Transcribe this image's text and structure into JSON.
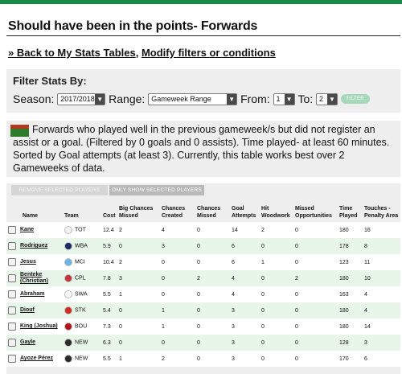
{
  "page": {
    "title": "Should have been in the points- Forwards",
    "back_link": "» Back to My Stats Tables",
    "separator": ",",
    "modify_link": "Modify filters or conditions",
    "accent_color": "#1a8a4a"
  },
  "filter": {
    "heading": "Filter Stats By:",
    "season_label": "Season:",
    "season_value": "2017/2018",
    "range_label": "Range:",
    "range_value": "Gameweek Range",
    "from_label": "From:",
    "from_value": "1",
    "to_label": "To:",
    "to_value": "2",
    "filter_button": "FILTER"
  },
  "description": {
    "icon": "pitch-icon",
    "text": "Forwards who played well in the previous gameweek/s but did not register an assist or a goal. (Filtered by 0 goals and 0 assists). Time played- at least 60 minutes. Sorted by Goal attempts (at least 3). Currently, this table works best over 2 Gameweeks of data."
  },
  "table": {
    "remove_selected_label": "REMOVE SELECTED PLAYERS",
    "only_show_selected_label": "ONLY SHOW SELECTED PLAYERS",
    "columns": [
      "Name",
      "Team",
      "Cost",
      "Big Chances Missed",
      "Chances Created",
      "Chances Missed",
      "Goal Attempts",
      "Hit Woodwork",
      "Missed Opportunities",
      "Time Played",
      "Touches - Penalty Area"
    ],
    "rows": [
      {
        "name": "Kane",
        "team": "TOT",
        "kit_color": "#f2f2f2",
        "cost": "12.4",
        "big_chances_missed": "2",
        "chances_created": "4",
        "chances_missed": "0",
        "goal_attempts": "14",
        "hit_woodwork": "2",
        "missed_opportunities": "0",
        "time_played": "180",
        "touches_penalty_area": "16"
      },
      {
        "name": "Rodriguez",
        "team": "WBA",
        "kit_color": "#1b2a63",
        "cost": "5.9",
        "big_chances_missed": "0",
        "chances_created": "3",
        "chances_missed": "0",
        "goal_attempts": "6",
        "hit_woodwork": "0",
        "missed_opportunities": "0",
        "time_played": "178",
        "touches_penalty_area": "8"
      },
      {
        "name": "Jesus",
        "team": "MCI",
        "kit_color": "#6cb4e4",
        "cost": "10.4",
        "big_chances_missed": "2",
        "chances_created": "0",
        "chances_missed": "0",
        "goal_attempts": "6",
        "hit_woodwork": "1",
        "missed_opportunities": "0",
        "time_played": "123",
        "touches_penalty_area": "11"
      },
      {
        "name": "Benteke (Christian)",
        "team": "CPL",
        "kit_color": "#c4343a",
        "cost": "7.8",
        "big_chances_missed": "3",
        "chances_created": "0",
        "chances_missed": "2",
        "goal_attempts": "4",
        "hit_woodwork": "0",
        "missed_opportunities": "2",
        "time_played": "180",
        "touches_penalty_area": "10"
      },
      {
        "name": "Abraham",
        "team": "SWA",
        "kit_color": "#f7f7f7",
        "cost": "5.5",
        "big_chances_missed": "1",
        "chances_created": "0",
        "chances_missed": "0",
        "goal_attempts": "4",
        "hit_woodwork": "0",
        "missed_opportunities": "0",
        "time_played": "163",
        "touches_penalty_area": "4"
      },
      {
        "name": "Diouf",
        "team": "STK",
        "kit_color": "#d52b1e",
        "cost": "5.4",
        "big_chances_missed": "0",
        "chances_created": "1",
        "chances_missed": "0",
        "goal_attempts": "3",
        "hit_woodwork": "0",
        "missed_opportunities": "0",
        "time_played": "180",
        "touches_penalty_area": "4"
      },
      {
        "name": "King (Joshua)",
        "team": "BOU",
        "kit_color": "#b5121b",
        "cost": "7.3",
        "big_chances_missed": "0",
        "chances_created": "1",
        "chances_missed": "0",
        "goal_attempts": "3",
        "hit_woodwork": "0",
        "missed_opportunities": "0",
        "time_played": "180",
        "touches_penalty_area": "14"
      },
      {
        "name": "Gayle",
        "team": "NEW",
        "kit_color": "#2a2a2a",
        "cost": "6.3",
        "big_chances_missed": "0",
        "chances_created": "0",
        "chances_missed": "0",
        "goal_attempts": "3",
        "hit_woodwork": "0",
        "missed_opportunities": "0",
        "time_played": "128",
        "touches_penalty_area": "3"
      },
      {
        "name": "Ayoze Pérez",
        "team": "NEW",
        "kit_color": "#2a2a2a",
        "cost": "5.5",
        "big_chances_missed": "1",
        "chances_created": "2",
        "chances_missed": "0",
        "goal_attempts": "3",
        "hit_woodwork": "0",
        "missed_opportunities": "0",
        "time_played": "170",
        "touches_penalty_area": "6"
      }
    ]
  }
}
